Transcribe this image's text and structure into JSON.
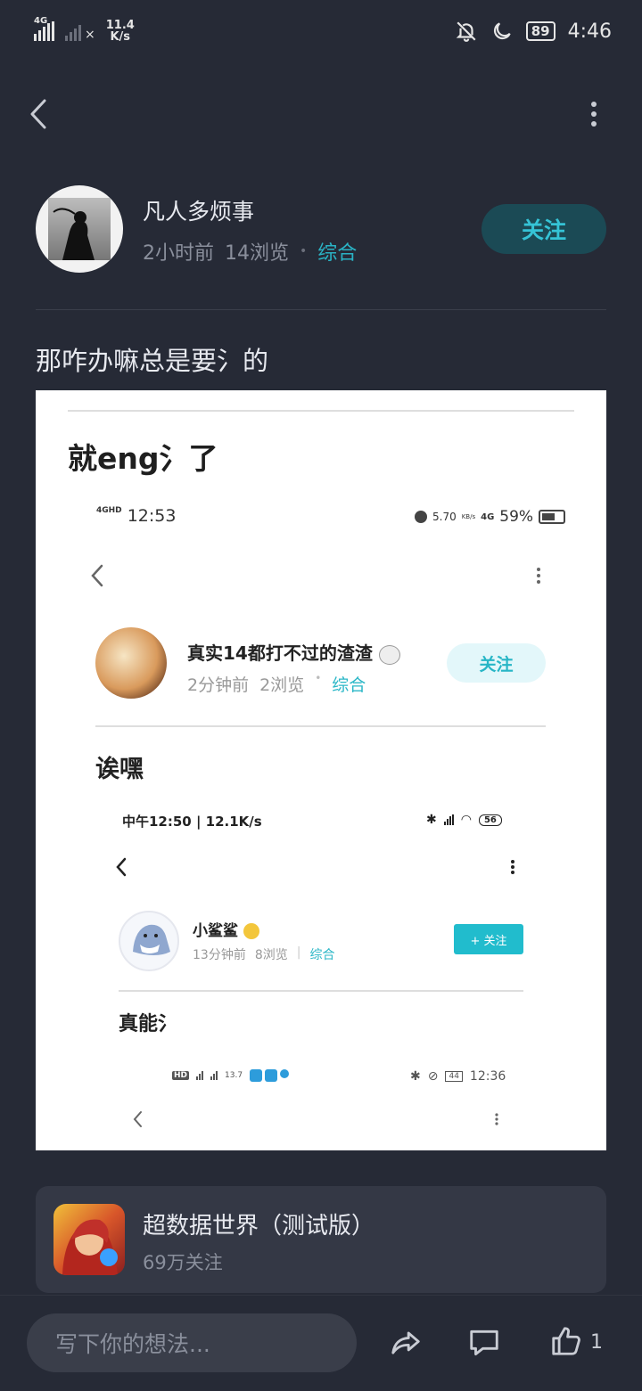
{
  "status_bar": {
    "network": "4G",
    "speed": "11.4",
    "speed_unit": "K/s",
    "battery": "89",
    "time": "4:46"
  },
  "post": {
    "author": "凡人多烦事",
    "time_ago": "2小时前",
    "views": "14浏览",
    "category": "综合",
    "follow_label": "关注",
    "text": "那咋办嘛总是要氵的"
  },
  "embedded_image": {
    "title1": "就eng氵了",
    "status1": {
      "network": "4GHD",
      "time": "12:53",
      "speed": "5.70",
      "speed_unit": "KB/s",
      "network2": "4G",
      "battery": "59%"
    },
    "post1": {
      "author": "真实14都打不过的渣渣",
      "time_ago": "2分钟前",
      "views": "2浏览",
      "category": "综合",
      "follow_label": "关注"
    },
    "title2": "诶嘿",
    "status2": {
      "time": "中午12:50 | 12.1K/s",
      "battery": "56"
    },
    "post2": {
      "author": "小鲨鲨",
      "time_ago": "13分钟前",
      "views": "8浏览",
      "category": "综合",
      "follow_label": "+ 关注"
    },
    "title3": "真能氵",
    "status3": {
      "left": "HD",
      "speed": "13.7",
      "speed_unit": "K/s",
      "battery": "44",
      "time": "12:36"
    }
  },
  "community": {
    "name": "超数据世界（测试版）",
    "followers": "69万关注"
  },
  "bottom_bar": {
    "input_placeholder": "写下你的想法...",
    "like_count": "1"
  }
}
